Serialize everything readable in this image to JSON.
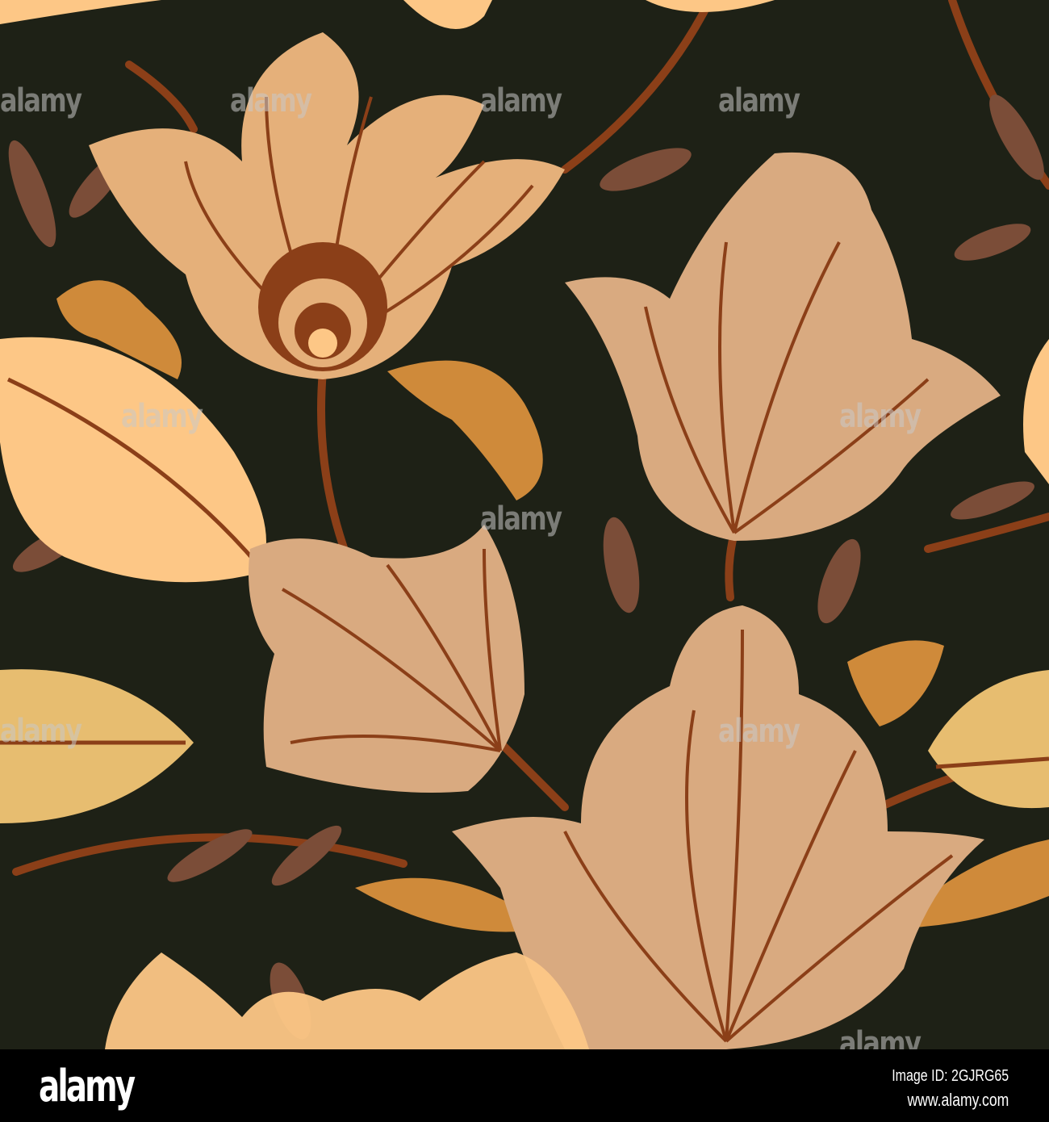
{
  "colors": {
    "background": "#1e2116",
    "petal_tan": "#e5b07a",
    "petal_beige": "#d9aa80",
    "leaf_pale": "#fdc786",
    "leaf_gold": "#e7bd70",
    "ochre": "#cf8a3a",
    "stem": "#8b3f18",
    "drop_brown": "#7b4d38"
  },
  "watermark": "alamy",
  "footer": {
    "logo": "alamy",
    "image_id": "Image ID: 2GJRG65",
    "website": "www.alamy.com"
  }
}
